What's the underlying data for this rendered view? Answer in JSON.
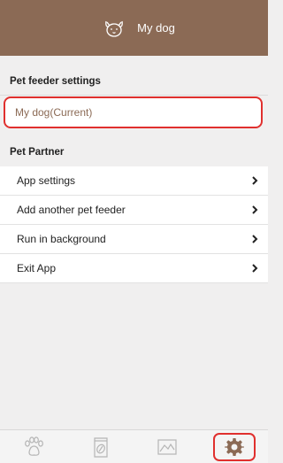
{
  "header": {
    "title": "My dog"
  },
  "feeder_settings": {
    "heading": "Pet feeder settings",
    "current_dog": "My dog(Current)"
  },
  "pet_partner": {
    "heading": "Pet Partner",
    "items": [
      {
        "label": "App settings"
      },
      {
        "label": "Add another pet feeder"
      },
      {
        "label": "Run in background"
      },
      {
        "label": "Exit App"
      }
    ]
  },
  "bottom_nav": {
    "tabs": [
      {
        "icon": "paw-icon",
        "active": false
      },
      {
        "icon": "food-bag-icon",
        "active": false
      },
      {
        "icon": "chart-icon",
        "active": false
      },
      {
        "icon": "gear-icon",
        "active": true
      }
    ]
  },
  "colors": {
    "header": "#8b6a55",
    "highlight": "#e0302e",
    "accent_text": "#8b6a55"
  }
}
